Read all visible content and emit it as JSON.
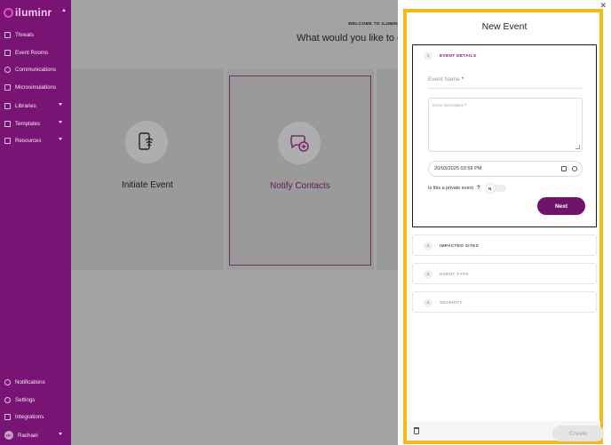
{
  "brand": {
    "name": "iluminr"
  },
  "sidebar": {
    "items": [
      {
        "label": "Threats",
        "icon": "threats-icon",
        "caret": false
      },
      {
        "label": "Event Rooms",
        "icon": "event-rooms-icon",
        "caret": false
      },
      {
        "label": "Communications",
        "icon": "communications-icon",
        "caret": false
      },
      {
        "label": "Microsimulations",
        "icon": "microsimulations-icon",
        "caret": false
      },
      {
        "label": "Libraries",
        "icon": "libraries-icon",
        "caret": true
      },
      {
        "label": "Templates",
        "icon": "templates-icon",
        "caret": true
      },
      {
        "label": "Resources",
        "icon": "resources-icon",
        "caret": true
      }
    ],
    "bottom_items": [
      {
        "label": "Notifications",
        "icon": "bell-icon"
      },
      {
        "label": "Settings",
        "icon": "gear-icon"
      },
      {
        "label": "Integrations",
        "icon": "link-icon"
      }
    ],
    "user": {
      "initials": "RF",
      "name": "Rachael"
    }
  },
  "main": {
    "welcome": "WELCOME TO ILUMINR",
    "question": "What would you like to do",
    "cards": [
      {
        "label": "Initiate Event",
        "icon": "touch-phone-icon"
      },
      {
        "label": "Notify Contacts",
        "icon": "chat-add-icon"
      }
    ]
  },
  "panel": {
    "title": "New Event",
    "close": "✕",
    "sections": [
      {
        "num": "1",
        "title": "EVENT DETAILS"
      },
      {
        "num": "2",
        "title": "IMPACTED SITES"
      },
      {
        "num": "3",
        "title": "EVENT TYPE"
      },
      {
        "num": "4",
        "title": "SEVERITY"
      }
    ],
    "form": {
      "name_placeholder": "Event Name",
      "description_placeholder": "Event Description",
      "required_mark": "*",
      "datetime": "20/03/2025 03:59 PM",
      "private_label": "Is this a private event",
      "help": "?",
      "toggle_value": "N",
      "next_label": "Next"
    },
    "create_label": "Create"
  },
  "colors": {
    "sidebar": "#7a1474",
    "accent": "#70126a",
    "highlight": "#f7b718"
  }
}
